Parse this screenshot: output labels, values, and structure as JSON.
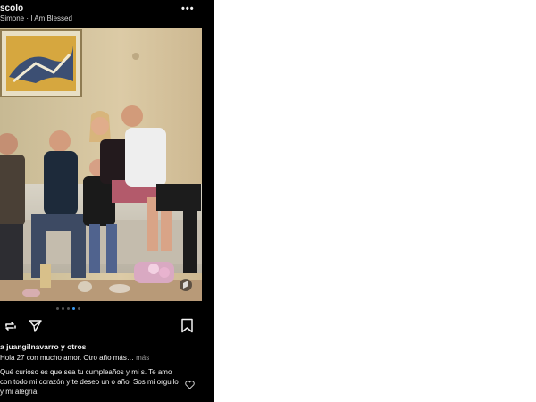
{
  "post": {
    "username": "scolo",
    "subtitle": "Simone · I Am Blessed",
    "more_label": "•••",
    "photo_alt": "Group photo on couch",
    "carousel": {
      "count": 5,
      "active_index": 3
    },
    "likes_text": "a juangilnavarro y otros",
    "comments": [
      {
        "text": "Hola 27 con mucho amor. Otro año más…",
        "more": "más"
      },
      {
        "text": "Qué curioso es que sea tu cumpleaños y mi s. Te amo con todo mi corazón y  te deseo un o año. Sos mi orgullo y mi alegría."
      }
    ]
  },
  "icons": {
    "repost": "repost-icon",
    "send": "send-icon",
    "save": "bookmark-icon",
    "heart": "heart-icon",
    "more": "more-options-icon"
  },
  "colors": {
    "background": "#000000",
    "text": "#f2f2f2",
    "muted": "#9a9a9a",
    "active_dot": "#3897f0"
  }
}
